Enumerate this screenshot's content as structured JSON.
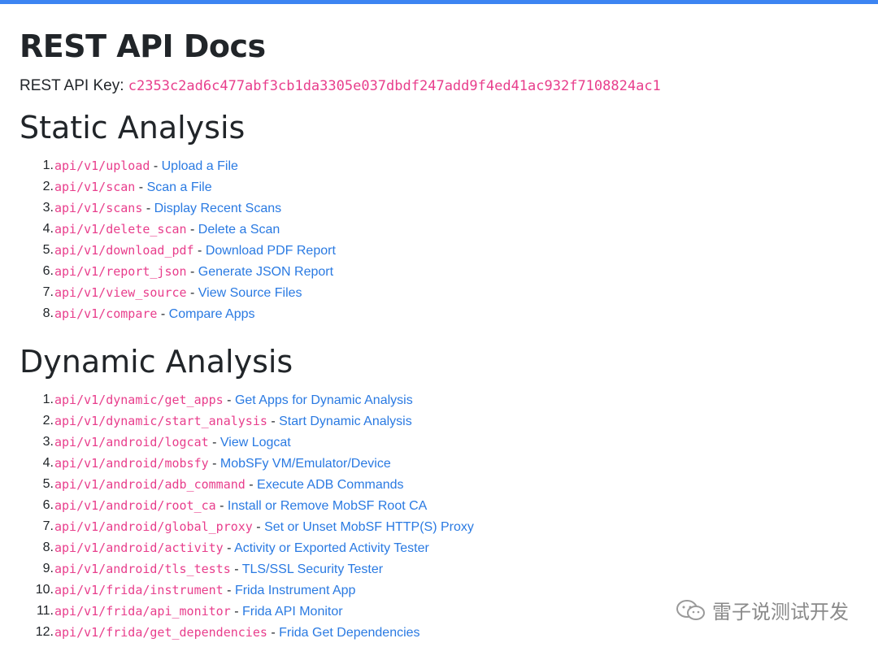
{
  "header": {
    "title": "REST API Docs",
    "api_key_label": "REST API Key:",
    "api_key_value": "c2353c2ad6c477abf3cb1da3305e037dbdf247add9f4ed41ac932f7108824ac1"
  },
  "static_analysis": {
    "title": "Static Analysis",
    "items": [
      {
        "num": "1.",
        "endpoint": "api/v1/upload",
        "sep": " - ",
        "desc": "Upload a File"
      },
      {
        "num": "2.",
        "endpoint": "api/v1/scan",
        "sep": " - ",
        "desc": "Scan a File"
      },
      {
        "num": "3.",
        "endpoint": "api/v1/scans",
        "sep": " - ",
        "desc": "Display Recent Scans"
      },
      {
        "num": "4.",
        "endpoint": "api/v1/delete_scan",
        "sep": " - ",
        "desc": "Delete a Scan"
      },
      {
        "num": "5.",
        "endpoint": "api/v1/download_pdf",
        "sep": " - ",
        "desc": "Download PDF Report"
      },
      {
        "num": "6.",
        "endpoint": "api/v1/report_json",
        "sep": " - ",
        "desc": "Generate JSON Report"
      },
      {
        "num": "7.",
        "endpoint": "api/v1/view_source",
        "sep": " - ",
        "desc": "View Source Files"
      },
      {
        "num": "8.",
        "endpoint": "api/v1/compare",
        "sep": " - ",
        "desc": "Compare Apps"
      }
    ]
  },
  "dynamic_analysis": {
    "title": "Dynamic Analysis",
    "items": [
      {
        "num": "1.",
        "endpoint": "api/v1/dynamic/get_apps",
        "sep": " - ",
        "desc": "Get Apps for Dynamic Analysis"
      },
      {
        "num": "2.",
        "endpoint": "api/v1/dynamic/start_analysis",
        "sep": " - ",
        "desc": "Start Dynamic Analysis"
      },
      {
        "num": "3.",
        "endpoint": "api/v1/android/logcat",
        "sep": " - ",
        "desc": "View Logcat"
      },
      {
        "num": "4.",
        "endpoint": "api/v1/android/mobsfy",
        "sep": " - ",
        "desc": "MobSFy VM/Emulator/Device"
      },
      {
        "num": "5.",
        "endpoint": "api/v1/android/adb_command",
        "sep": " - ",
        "desc": "Execute ADB Commands"
      },
      {
        "num": "6.",
        "endpoint": "api/v1/android/root_ca",
        "sep": " - ",
        "desc": "Install or Remove MobSF Root CA"
      },
      {
        "num": "7.",
        "endpoint": "api/v1/android/global_proxy",
        "sep": " - ",
        "desc": "Set or Unset MobSF HTTP(S) Proxy"
      },
      {
        "num": "8.",
        "endpoint": "api/v1/android/activity",
        "sep": " - ",
        "desc": "Activity or Exported Activity Tester"
      },
      {
        "num": "9.",
        "endpoint": "api/v1/android/tls_tests",
        "sep": " - ",
        "desc": "TLS/SSL Security Tester"
      },
      {
        "num": "10.",
        "endpoint": "api/v1/frida/instrument",
        "sep": " - ",
        "desc": "Frida Instrument App"
      },
      {
        "num": "11.",
        "endpoint": "api/v1/frida/api_monitor",
        "sep": " - ",
        "desc": "Frida API Monitor"
      },
      {
        "num": "12.",
        "endpoint": "api/v1/frida/get_dependencies",
        "sep": " - ",
        "desc": "Frida Get Dependencies"
      }
    ]
  },
  "watermark": {
    "text": "雷子说测试开发",
    "icon": "wechat-icon"
  },
  "colors": {
    "top_bar": "#3c84f2",
    "code": "#e83e8c",
    "link": "#2a7ae2",
    "text": "#212529"
  }
}
